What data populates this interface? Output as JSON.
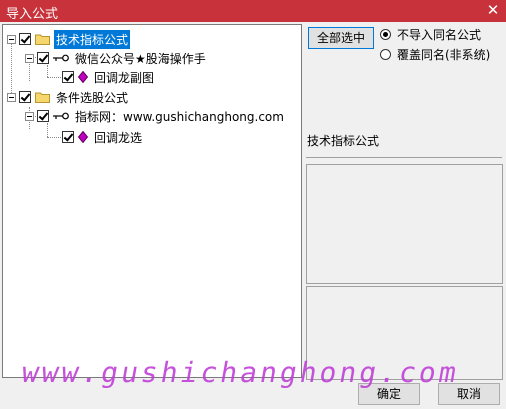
{
  "window": {
    "title": "导入公式",
    "close_glyph": "✕"
  },
  "tree": {
    "group1": {
      "label": "技术指标公式",
      "author": {
        "label": "微信公众号★股海操作手",
        "formula": {
          "label": "回调龙副图"
        }
      }
    },
    "group2": {
      "label": "条件选股公式",
      "author": {
        "label": "指标网：www.gushichanghong.com",
        "formula": {
          "label": "回调龙选"
        }
      }
    }
  },
  "controls": {
    "select_all": "全部选中",
    "options": [
      {
        "label": "不导入同名公式",
        "checked": true
      },
      {
        "label": "覆盖同名(非系统)",
        "checked": false
      }
    ]
  },
  "info": {
    "type_label": "技术指标公式"
  },
  "buttons": {
    "ok": "确定",
    "cancel": "取消"
  },
  "watermark": "www.gushichanghong.com",
  "colors": {
    "titlebar": "#c8323a",
    "selection": "#0078d7",
    "watermark": "#c040d8",
    "formula_icon": "#c000c0"
  }
}
